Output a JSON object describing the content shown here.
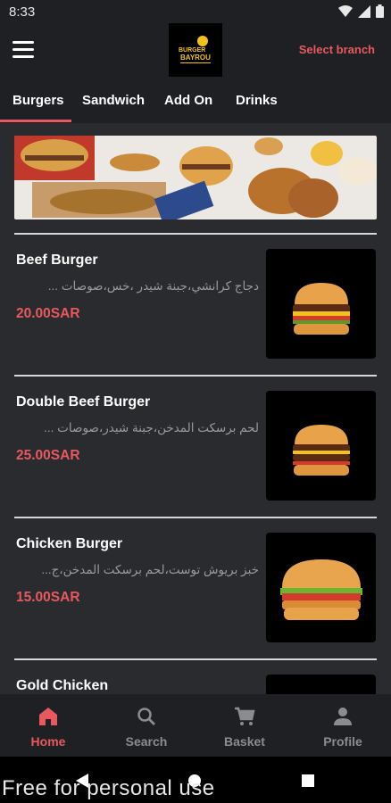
{
  "status": {
    "time": "8:33"
  },
  "header": {
    "branch_label": "Select branch",
    "logo_text": "BAYROU"
  },
  "tabs": [
    {
      "label": "Burgers",
      "active": true
    },
    {
      "label": "Sandwich",
      "active": false
    },
    {
      "label": "Add On",
      "active": false
    },
    {
      "label": "Drinks",
      "active": false
    }
  ],
  "items": [
    {
      "name": "Beef Burger",
      "desc": "دجاج كرانشي،جبنة شيدر ،خس،صوصات ...",
      "price": "20.00SAR"
    },
    {
      "name": "Double Beef Burger",
      "desc": "لحم برسكت المدخن،جبنة شيدر،صوصات ...",
      "price": "25.00SAR"
    },
    {
      "name": "Chicken Burger",
      "desc": "خبز بريوش توست،لحم برسكت المدخن،ج...",
      "price": "15.00SAR"
    },
    {
      "name": "Gold Chicken",
      "desc": "",
      "price": ""
    }
  ],
  "bottom_nav": [
    {
      "label": "Home",
      "icon": "home-icon",
      "active": true
    },
    {
      "label": "Search",
      "icon": "search-icon",
      "active": false
    },
    {
      "label": "Basket",
      "icon": "cart-icon",
      "active": false
    },
    {
      "label": "Profile",
      "icon": "person-icon",
      "active": false
    }
  ],
  "watermark": "Free for personal use",
  "colors": {
    "accent": "#e8595f",
    "background": "#2a2b2f",
    "bar": "#1f2024"
  }
}
